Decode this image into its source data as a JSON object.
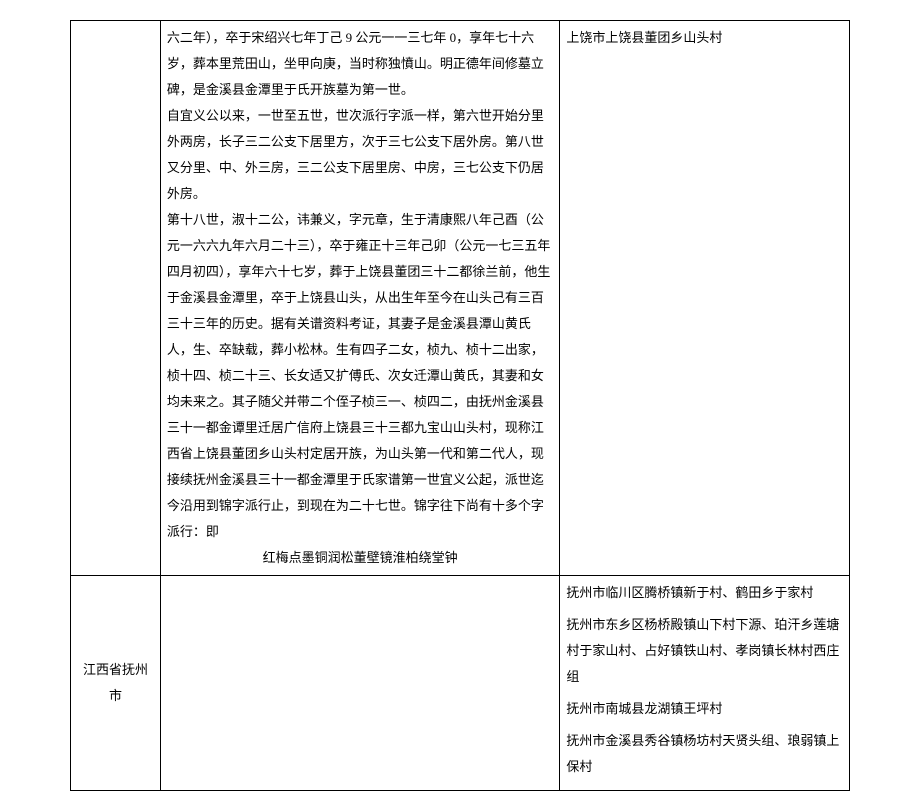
{
  "row1": {
    "col1": "",
    "col2": {
      "p1": "六二年），卒于宋绍兴七年丁己 9 公元一一三七年 0，享年七十六岁，葬本里荒田山，坐甲向庚，当时称独憤山。明正德年间修墓立碑，是金溪县金潭里于氏开族墓为第一世。",
      "p2": "自宜义公以来，一世至五世，世次派行字派一样，第六世开始分里外两房，长子三二公支下居里方，次于三七公支下居外房。第八世又分里、中、外三房，三二公支下居里房、中房，三七公支下仍居外房。",
      "p3": "第十八世，淑十二公，讳兼义，字元章，生于清康熙八年己酉（公元一六六九年六月二十三），卒于雍正十三年己卯（公元一七三五年四月初四），享年六十七岁，葬于上饶县董团三十二都徐兰前，他生于金溪县金潭里，卒于上饶县山头，从出生年至今在山头己有三百三十三年的历史。据有关谱资料考证，其妻子是金溪县潭山黄氏人，生、卒缺载，葬小松林。生有四子二女，桢九、桢十二出家，桢十四、桢二十三、长女适又扩傅氏、次女迁潭山黄氏，其妻和女均未来之。其子随父并带二个侄子桢三一、桢四二，由抚州金溪县三十一都金谭里迁居广信府上饶县三十三都九宝山山头村，现称江西省上饶县董团乡山头村定居开族，为山头第一代和第二代人，现接续抚州金溪县三十一都金潭里于氏家谱第一世宜义公起，派世迄今沿用到锦字派行止，到现在为二十七世。锦字往下尚有十多个字派行：即",
      "p4": "红梅点墨铜润松董壁镜淮柏绕堂钟"
    },
    "col3": "上饶市上饶县董团乡山头村"
  },
  "row2": {
    "col1": "江西省抚州市",
    "col2": "",
    "col3": {
      "l1": "抚州市临川区腾桥镇新于村、鹤田乡于家村",
      "l2": "抚州市东乡区杨桥殿镇山下村下源、珀汗乡莲塘村于家山村、占好镇铁山村、孝岗镇长林村西庄组",
      "l3": "抚州市南城县龙湖镇王坪村",
      "l4": "抚州市金溪县秀谷镇杨坊村天贤头组、琅弱镇上保村"
    }
  }
}
